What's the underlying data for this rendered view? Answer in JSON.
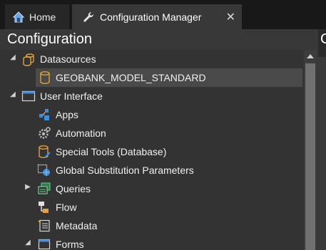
{
  "tabs": [
    {
      "label": "Home",
      "icon": "home-icon"
    },
    {
      "label": "Configuration Manager",
      "icon": "wrench-icon",
      "close_glyph": "✕"
    }
  ],
  "panel": {
    "title": "Configuration"
  },
  "right_panel": {
    "title_fragment": "C"
  },
  "tree": [
    {
      "label": "Datasources",
      "icon": "datasources-icon",
      "expander": "expanded"
    },
    {
      "label": "GEOBANK_MODEL_STANDARD",
      "icon": "database-icon",
      "selected": true
    },
    {
      "label": "User Interface",
      "icon": "window-icon",
      "expander": "expanded"
    },
    {
      "label": "Apps",
      "icon": "apps-icon"
    },
    {
      "label": "Automation",
      "icon": "automation-gear-icon"
    },
    {
      "label": "Special Tools (Database)",
      "icon": "database-tool-icon"
    },
    {
      "label": "Global Substitution Parameters",
      "icon": "globe-parameters-icon"
    },
    {
      "label": "Queries",
      "icon": "queries-icon",
      "expander": "collapsed"
    },
    {
      "label": "Flow",
      "icon": "flow-icon"
    },
    {
      "label": "Metadata",
      "icon": "metadata-icon"
    },
    {
      "label": "Forms",
      "icon": "forms-icon",
      "expander": "expanded"
    }
  ],
  "colors": {
    "background": "#2d2d2d",
    "tab_active": "#383838",
    "selection": "#4a4a4a",
    "folder_accent": "#e0a13a",
    "blue_accent": "#3b8ee0"
  }
}
